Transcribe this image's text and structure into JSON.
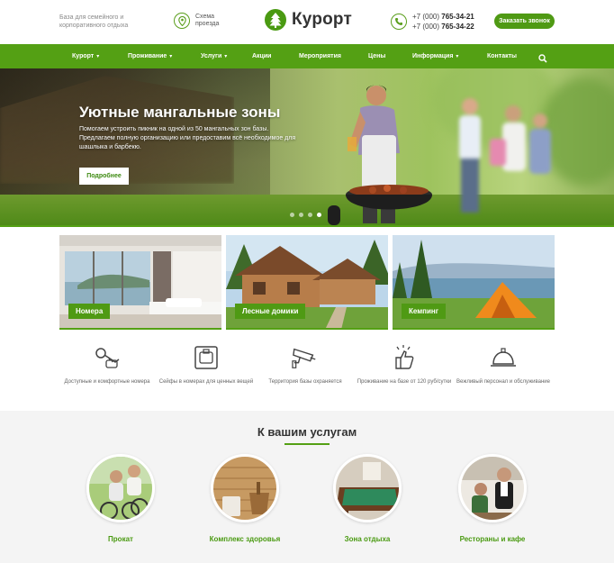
{
  "header": {
    "tagline": "База для семейного и корпоративного отдыха",
    "map_link": "Схема проезда",
    "logo": "Курорт",
    "phone1_prefix": "+7 (000) ",
    "phone1_number": "765-34-21",
    "phone2_prefix": "+7 (000) ",
    "phone2_number": "765-34-22",
    "callback_button": "Заказать звонок"
  },
  "nav": {
    "items": [
      {
        "label": "Курорт",
        "has_dropdown": true
      },
      {
        "label": "Проживание",
        "has_dropdown": true
      },
      {
        "label": "Услуги",
        "has_dropdown": true
      },
      {
        "label": "Акции",
        "has_dropdown": false
      },
      {
        "label": "Мероприятия",
        "has_dropdown": false
      },
      {
        "label": "Цены",
        "has_dropdown": false
      },
      {
        "label": "Информация",
        "has_dropdown": true
      },
      {
        "label": "Контакты",
        "has_dropdown": false
      }
    ],
    "search_icon": "search-icon"
  },
  "hero": {
    "title": "Уютные мангальные зоны",
    "text": "Помогаем устроить пикник на одной из 50 мангальных зон базы. Предлагаем полную организацию или предоставим всё необходимое для шашлыка и барбекю.",
    "button": "Подробнее",
    "slides": 4,
    "active_slide": 3
  },
  "tiles": [
    {
      "label": "Номера"
    },
    {
      "label": "Лесные домики"
    },
    {
      "label": "Кемпинг"
    }
  ],
  "features": [
    {
      "icon": "key-icon",
      "text": "Доступные и комфортные номера"
    },
    {
      "icon": "safe-icon",
      "text": "Сейфы в номерах для ценных вещей"
    },
    {
      "icon": "cctv-camera-icon",
      "text": "Территория базы охраняется"
    },
    {
      "icon": "thumbs-up-icon",
      "text": "Проживание на базе от 120 руб/сутки"
    },
    {
      "icon": "service-bell-icon",
      "text": "Вежливый персонал и обслуживание"
    }
  ],
  "services": {
    "title": "К вашим услугам",
    "items": [
      {
        "label": "Прокат"
      },
      {
        "label": "Комплекс здоровья"
      },
      {
        "label": "Зона отдыха"
      },
      {
        "label": "Рестораны и кафе"
      }
    ]
  },
  "colors": {
    "accent": "#54a014",
    "button": "#4f9a14",
    "services_bg": "#f4f4f4"
  }
}
